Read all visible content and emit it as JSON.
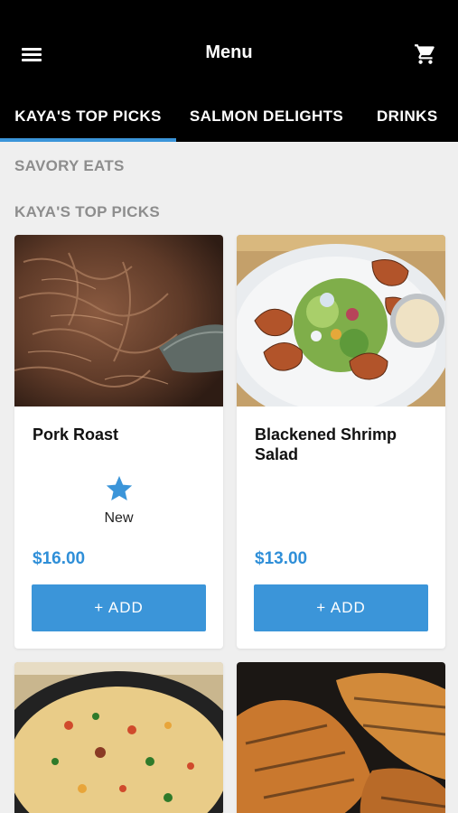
{
  "header": {
    "title": "Menu",
    "menu_icon": "hamburger-menu-icon",
    "cart_icon": "shopping-cart-icon"
  },
  "tabs": [
    {
      "label": "KAYA'S TOP PICKS",
      "active": true
    },
    {
      "label": "SALMON DELIGHTS",
      "active": false
    },
    {
      "label": "DRINKS",
      "active": false
    }
  ],
  "colors": {
    "header_bg": "#000000",
    "accent": "#3b95d9",
    "price": "#2f8fd8",
    "page_bg": "#efefef",
    "section_label": "#8d8d8d"
  },
  "sections": {
    "category": "SAVORY EATS",
    "subcategory": "KAYA'S TOP PICKS"
  },
  "items": [
    {
      "name": "Pork Roast",
      "price": "$16.00",
      "badge": {
        "icon": "star-icon",
        "label": "New"
      },
      "add_label": "+ ADD"
    },
    {
      "name": "Blackened Shrimp Salad",
      "price": "$13.00",
      "add_label": "+ ADD"
    },
    {
      "name": "",
      "price": "",
      "add_label": ""
    },
    {
      "name": "",
      "price": "",
      "add_label": ""
    }
  ]
}
